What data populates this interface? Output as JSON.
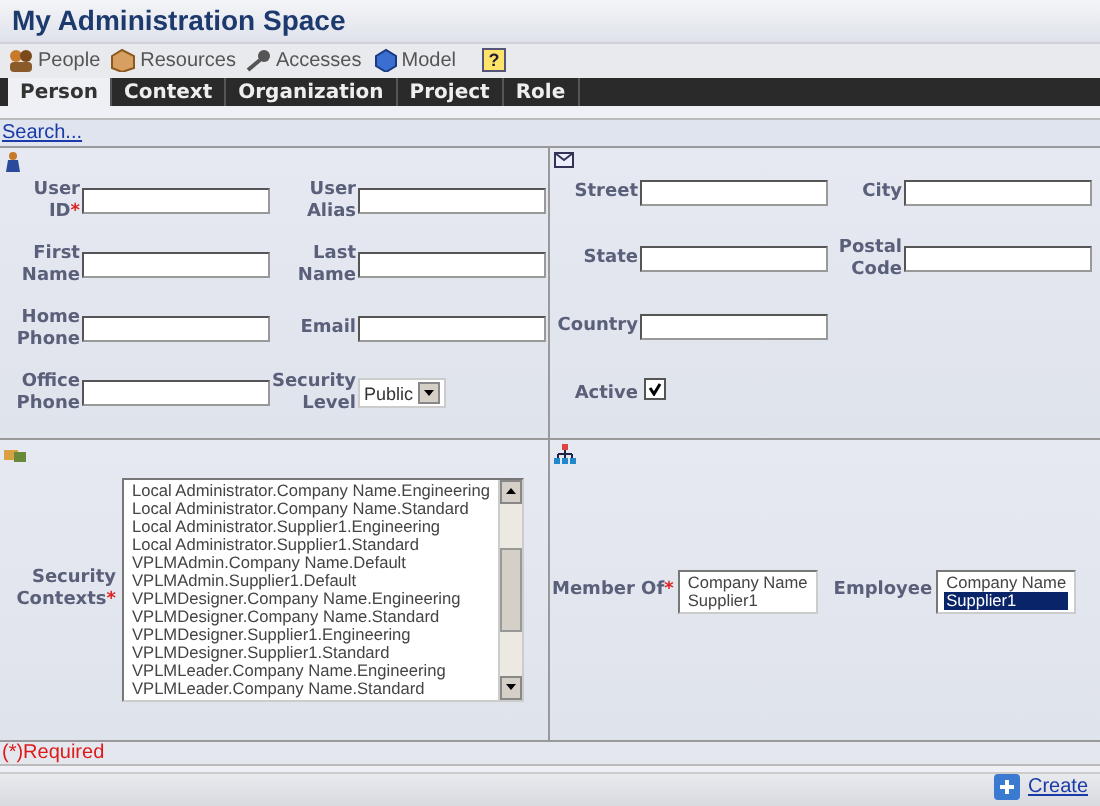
{
  "window": {
    "title": "My Administration Space"
  },
  "toolbar": [
    {
      "label": "People",
      "kind": "people"
    },
    {
      "label": "Resources",
      "kind": "resources"
    },
    {
      "label": "Accesses",
      "kind": "accesses"
    },
    {
      "label": "Model",
      "kind": "model"
    }
  ],
  "help": "?",
  "tabs": [
    {
      "label": "Person",
      "selected": true
    },
    {
      "label": "Context",
      "selected": false
    },
    {
      "label": "Organization",
      "selected": false
    },
    {
      "label": "Project",
      "selected": false
    },
    {
      "label": "Role",
      "selected": false
    }
  ],
  "search_link": "Search...",
  "person_fields": [
    {
      "label": "User ID",
      "mark": "*",
      "kind": "text"
    },
    {
      "label": "User Alias",
      "kind": "text"
    },
    {
      "label": "First Name",
      "kind": "text"
    },
    {
      "label": "Last Name",
      "kind": "text"
    },
    {
      "label": "Home Phone",
      "kind": "text"
    },
    {
      "label": "Email",
      "kind": "text"
    },
    {
      "label": "Office Phone",
      "kind": "text"
    },
    {
      "label": "Security Level",
      "kind": "select",
      "value": "Public"
    }
  ],
  "address_fields": [
    {
      "label": "Street",
      "kind": "text"
    },
    {
      "label": "City",
      "kind": "text"
    },
    {
      "label": "State",
      "kind": "text"
    },
    {
      "label": "Postal Code",
      "kind": "text"
    },
    {
      "label": "Country",
      "kind": "text"
    },
    {
      "label": "Active",
      "kind": "checkbox",
      "checked": true
    }
  ],
  "security_contexts": {
    "label": "Security Contexts",
    "mark": "*",
    "items": [
      {
        "label": "Local Administrator.Company Name.Engineering",
        "selected": false
      },
      {
        "label": "Local Administrator.Company Name.Standard",
        "selected": false
      },
      {
        "label": "Local Administrator.Supplier1.Engineering",
        "selected": false
      },
      {
        "label": "Local Administrator.Supplier1.Standard",
        "selected": false
      },
      {
        "label": "VPLMAdmin.Company Name.Default",
        "selected": false
      },
      {
        "label": "VPLMAdmin.Supplier1.Default",
        "selected": false
      },
      {
        "label": "VPLMDesigner.Company Name.Engineering",
        "selected": false
      },
      {
        "label": "VPLMDesigner.Company Name.Standard",
        "selected": false
      },
      {
        "label": "VPLMDesigner.Supplier1.Engineering",
        "selected": false
      },
      {
        "label": "VPLMDesigner.Supplier1.Standard",
        "selected": false
      },
      {
        "label": "VPLMLeader.Company Name.Engineering",
        "selected": false
      },
      {
        "label": "VPLMLeader.Company Name.Standard",
        "selected": false
      }
    ]
  },
  "member_of": {
    "label": "Member Of",
    "mark": "*",
    "items": [
      {
        "label": "Company Name",
        "selected": false
      },
      {
        "label": "Supplier1",
        "selected": false
      }
    ]
  },
  "employee": {
    "label": "Employee",
    "items": [
      {
        "label": "Company Name",
        "selected": false
      },
      {
        "label": "Supplier1",
        "selected": true
      }
    ]
  },
  "required_note": "(*)Required",
  "create_button": "Create"
}
